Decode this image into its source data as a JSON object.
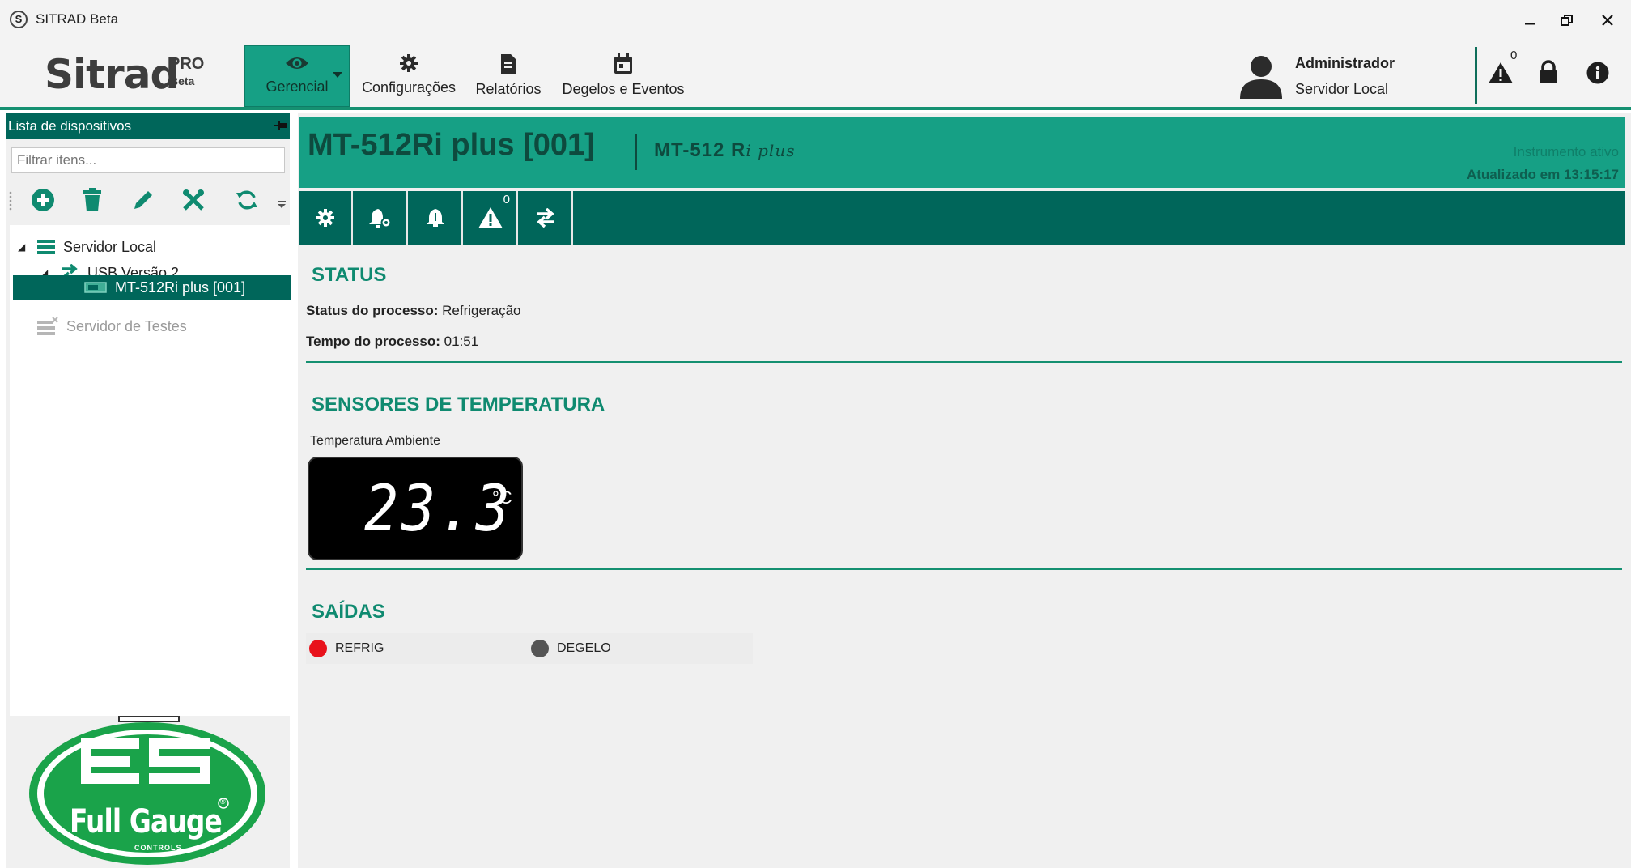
{
  "window": {
    "title": "SITRAD Beta",
    "app_icon_letter": "S",
    "controls": [
      "minimize",
      "restore",
      "close"
    ]
  },
  "header": {
    "logo": {
      "word": "Sitrad",
      "pro": "PRO",
      "beta": "Beta"
    },
    "nav": [
      {
        "label": "Gerencial",
        "icon": "eye-icon",
        "active": true
      },
      {
        "label": "Configurações",
        "icon": "gear-icon"
      },
      {
        "label": "Relatórios",
        "icon": "document-icon"
      },
      {
        "label": "Degelos e Eventos",
        "icon": "calendar-icon"
      }
    ],
    "user": {
      "name": "Administrador",
      "server": "Servidor Local"
    },
    "alert_count": "0",
    "accent_color": "#16a085",
    "dark_color": "#00665a"
  },
  "left_panel": {
    "title": "Lista de dispositivos",
    "filter_placeholder": "Filtrar itens...",
    "tree": [
      {
        "label": "Servidor Local",
        "level": 0,
        "expanded": true,
        "icon": "server-icon"
      },
      {
        "label": "USB Versão 2",
        "level": 1,
        "expanded": true,
        "icon": "transfer-icon"
      },
      {
        "label": "MT-512Ri plus [001]",
        "level": 2,
        "selected": true,
        "icon": "device-icon"
      },
      {
        "label": "Servidor de Testes",
        "level": 0,
        "disabled": true,
        "icon": "server-disconnected-icon"
      }
    ],
    "brand": {
      "word": "Full Gauge",
      "sub": "CONTROLS",
      "registered": "®"
    }
  },
  "device": {
    "title": "MT-512Ri plus [001]",
    "model": "MT-512 R",
    "model_suffix": "i plus",
    "state": "Instrumento ativo",
    "updated": "Atualizado em 13:15:17",
    "toolbar_alert_count": "0",
    "status": {
      "title": "STATUS",
      "process_status_label": "Status do processo:",
      "process_status_value": "Refrigeração",
      "process_time_label": "Tempo do processo:",
      "process_time_value": "01:51"
    },
    "sensors": {
      "title": "SENSORES DE TEMPERATURA",
      "items": [
        {
          "label": "Temperatura Ambiente",
          "value": "23.3",
          "unit": "°C"
        }
      ]
    },
    "outputs": {
      "title": "SAÍDAS",
      "items": [
        {
          "label": "REFRIG",
          "state": "on",
          "color": "#e8121b"
        },
        {
          "label": "DEGELO",
          "state": "off",
          "color": "#555555"
        }
      ]
    }
  }
}
